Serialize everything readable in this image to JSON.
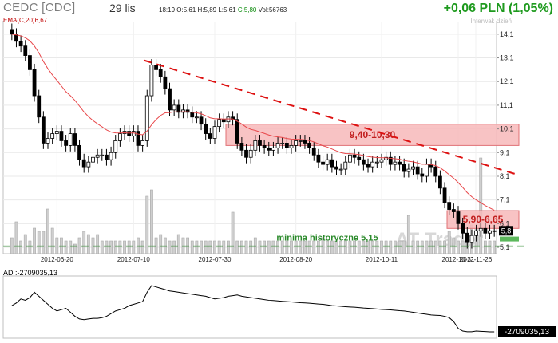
{
  "header": {
    "title": "CEDC [CDC]",
    "date": "29 lis",
    "time": "18:19",
    "open": "O:5,61",
    "high": "H:5,89",
    "low": "L:5,61",
    "close": "C:5,80",
    "volume": "Vol:56763",
    "change": "+0,06 PLN (1,05%)",
    "interval": "Interwał: dzień",
    "ema": "EMA(C,20)6,67",
    "ad": "AD :-2709035,13"
  },
  "chart_data": {
    "type": "candlestick",
    "x_tick_labels": [
      "2012-06-20",
      "2012-07-10",
      "2012-07-30",
      "2012-08-20",
      "2012-10-11",
      "2012-10-31",
      "2012-11-26"
    ],
    "y_tick_labels": [
      "14,1",
      "13,1",
      "12,1",
      "11,1",
      "10,1",
      "9,1",
      "8,1",
      "7,1",
      "6,1",
      "5,1"
    ],
    "ylim": [
      4.9,
      14.6
    ],
    "current_price_label": "5,8",
    "last_price": 5.8,
    "ema_period": 20,
    "closes": [
      14.1,
      13.8,
      13.6,
      13.2,
      12.6,
      11.5,
      10.6,
      9.5,
      9.7,
      9.9,
      10.0,
      9.6,
      9.4,
      9.9,
      9.4,
      8.8,
      8.5,
      8.7,
      8.9,
      9.0,
      9.0,
      8.8,
      9.1,
      9.6,
      9.9,
      10.0,
      9.8,
      10.0,
      9.4,
      9.6,
      11.5,
      12.8,
      12.6,
      12.3,
      11.8,
      10.9,
      11.1,
      10.8,
      10.9,
      10.8,
      10.6,
      10.6,
      10.3,
      9.9,
      9.7,
      10.2,
      10.5,
      10.4,
      10.6,
      10.5,
      9.5,
      9.2,
      8.9,
      9.2,
      9.6,
      9.4,
      9.3,
      9.2,
      9.3,
      9.5,
      9.5,
      9.3,
      9.4,
      9.6,
      9.6,
      9.5,
      9.3,
      9.0,
      8.7,
      8.6,
      8.8,
      8.5,
      8.4,
      8.4,
      8.7,
      9.0,
      8.9,
      8.8,
      8.6,
      8.5,
      8.7,
      8.7,
      8.8,
      8.9,
      8.6,
      8.7,
      8.6,
      8.3,
      8.4,
      8.5,
      8.2,
      8.1,
      8.6,
      8.5,
      8.1,
      7.6,
      7.0,
      6.7,
      6.6,
      6.1,
      5.7,
      5.3,
      5.6,
      5.8,
      5.9,
      5.7,
      5.8,
      5.8
    ],
    "volume_index": [
      5,
      10,
      4,
      6,
      4,
      8,
      7,
      7,
      14,
      8,
      5,
      5,
      4,
      4,
      3,
      5,
      7,
      6,
      5,
      6,
      4,
      4,
      4,
      4,
      4,
      4,
      4,
      4,
      5,
      4,
      18,
      20,
      5,
      6,
      5,
      4,
      4,
      6,
      5,
      5,
      4,
      4,
      4,
      4,
      4,
      4,
      4,
      4,
      4,
      13,
      4,
      4,
      4,
      4,
      5,
      4,
      4,
      4,
      4,
      4,
      4,
      4,
      4,
      4,
      4,
      4,
      4,
      4,
      4,
      5,
      4,
      4,
      4,
      4,
      4,
      4,
      4,
      4,
      4,
      4,
      4,
      4,
      4,
      4,
      4,
      4,
      4,
      4,
      12,
      4,
      4,
      4,
      4,
      4,
      4,
      4,
      4,
      7,
      5,
      4,
      4,
      4,
      9,
      8,
      30,
      4,
      4,
      4
    ],
    "annotations": [
      {
        "text": "9,40-10,30",
        "from": 9.4,
        "to": 10.3
      },
      {
        "text": "5,90-6,65",
        "from": 5.9,
        "to": 6.65
      },
      {
        "text": "minima historyczne 5,15",
        "level": 5.15
      }
    ],
    "trendline": {
      "from_price": 13.0,
      "to_price": 8.15
    },
    "ad_indicator": {
      "name": "AD",
      "last_label": "-2709035,13",
      "last": -2709035.13,
      "values": [
        -300,
        -280,
        -250,
        -260,
        -240,
        -200,
        -230,
        -260,
        -290,
        -320,
        -340,
        -330,
        -320,
        -350,
        -380,
        -400,
        -405,
        -400,
        -395,
        -395,
        -390,
        -380,
        -360,
        -340,
        -330,
        -320,
        -300,
        -290,
        -280,
        -270,
        -200,
        -150,
        -160,
        -170,
        -180,
        -190,
        -195,
        -200,
        -205,
        -210,
        -215,
        -220,
        -225,
        -230,
        -240,
        -250,
        -245,
        -240,
        -230,
        -225,
        -220,
        -230,
        -235,
        -240,
        -245,
        -250,
        -255,
        -260,
        -262,
        -265,
        -268,
        -270,
        -272,
        -275,
        -278,
        -280,
        -282,
        -285,
        -288,
        -290,
        -295,
        -300,
        -302,
        -305,
        -308,
        -310,
        -312,
        -315,
        -318,
        -320,
        -322,
        -325,
        -328,
        -330,
        -332,
        -335,
        -338,
        -340,
        -345,
        -350,
        -355,
        -360,
        -365,
        -370,
        -372,
        -374,
        -380,
        -390,
        -420,
        -470,
        -490,
        -495,
        -495,
        -490,
        -492,
        -494,
        -496,
        -496
      ]
    }
  },
  "watermark": "AT Trader",
  "colors": {
    "up_candle": "#ffffff",
    "down_candle": "#000000",
    "ema": "#e8474a",
    "trendline": "#dd1111",
    "zone_fill": "#f7b8ba",
    "zone_text": "#c11d1d",
    "support": "#2b8a2b",
    "volume": "#cfcfcf",
    "grid": "#e9e9e9"
  }
}
